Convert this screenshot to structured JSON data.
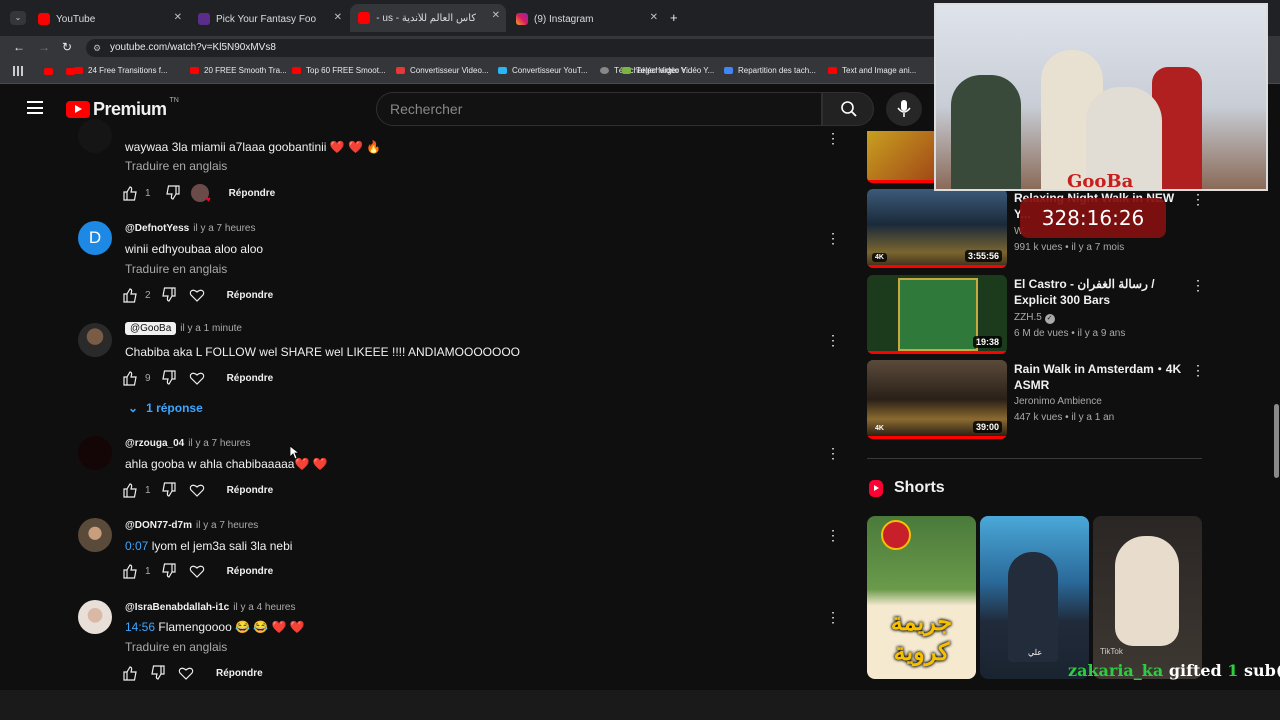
{
  "browser": {
    "tabs": [
      {
        "title": "YouTube",
        "favicon": "youtube-icon",
        "active": false
      },
      {
        "title": "Pick Your Fantasy Football Team",
        "favicon": "fantasy-icon",
        "active": false
      },
      {
        "title": "كأس العالم للأندية - us - قضيت",
        "favicon": "youtube-icon",
        "active": true
      },
      {
        "title": "(9) Instagram",
        "favicon": "instagram-icon",
        "active": false
      }
    ],
    "new_tab": "+",
    "url": "youtube.com/watch?v=Kl5N90xMVs8",
    "bookmarks": [
      "24 Free Transitions f...",
      "20 FREE Smooth Tra...",
      "Top 60 FREE Smoot...",
      "Convertisseur Video...",
      "Convertisseur YouT...",
      "Télécharger Vidéo Y...",
      "Repartition des tach...",
      "Text and Image ani..."
    ]
  },
  "header": {
    "logo_text": "Premium",
    "logo_sup": "TN",
    "search_placeholder": "Rechercher"
  },
  "comments": [
    {
      "author": "",
      "time": "",
      "ts": "",
      "text": "waywaa 3la miamii a7laaa goobantinii ❤️ ❤️ 🔥",
      "translate": "Traduire en anglais",
      "likes": "1",
      "creator_heart": true,
      "reply": "Répondre"
    },
    {
      "author": "@DefnotYess",
      "time": "il y a 7 heures",
      "ts": "",
      "text": "winii edhyoubaa aloo aloo",
      "translate": "Traduire en anglais",
      "likes": "2",
      "avatar_letter": "D",
      "reply": "Répondre"
    },
    {
      "author": "@GooBa",
      "time": "il y a 1 minute",
      "ts": "",
      "text": "Chabiba aka L FOLLOW wel SHARE wel LIKEEE !!!! ANDIAMOOOOOOO",
      "translate": "",
      "likes": "9",
      "reply": "Répondre",
      "replies": "1 réponse"
    },
    {
      "author": "@rzouga_04",
      "time": "il y a 7 heures",
      "ts": "",
      "text": "ahla gooba w ahla chabibaaaaa❤️ ❤️",
      "translate": "",
      "likes": "1",
      "reply": "Répondre"
    },
    {
      "author": "@DON77-d7m",
      "time": "il y a 7 heures",
      "ts": "0:07",
      "text": " lyom el jem3a sali 3la nebi",
      "translate": "",
      "likes": "1",
      "reply": "Répondre"
    },
    {
      "author": "@IsraBenabdallah-i1c",
      "time": "il y a 4 heures",
      "ts": "14:56",
      "text": " Flamengoooo 😂 😂 ❤️ ❤️",
      "translate": "Traduire en anglais",
      "likes": "",
      "reply": "Répondre"
    }
  ],
  "related": [
    {
      "title": "Relaxing Night Walk in NEW Y...",
      "channel": "W...",
      "meta": "991 k vues • il y a 7 mois",
      "duration": "3:55:56",
      "badge": "4K",
      "verified": false
    },
    {
      "title": "El Castro - رسالة الغفران / Explicit 300 Bars",
      "channel": "ZZH.5",
      "meta": "6 M de vues • il y a 9 ans",
      "duration": "19:38",
      "badge": "",
      "verified": true
    },
    {
      "title": "Rain Walk in Amsterdam・4K ASMR",
      "channel": "Jeronimo Ambience",
      "meta": "447 k vues • il y a 1 an",
      "duration": "39:00",
      "badge": "4K",
      "verified": false
    }
  ],
  "shorts": {
    "heading": "Shorts",
    "items": [
      {
        "caption": "جريمة كروية"
      },
      {
        "caption": "علي"
      },
      {
        "caption": "TikTok"
      }
    ]
  },
  "overlay": {
    "cam_label": "GooBa",
    "timer": "328:16:26",
    "gift_user": "zakaria_ka",
    "gift_word": "gifted",
    "gift_count": "1",
    "gift_suffix": "sub(s)!"
  },
  "colors": {
    "accent": "#ff0000",
    "link": "#3ea6ff",
    "timer_bg": "#820f0f",
    "gift_user": "#2ecc40"
  }
}
